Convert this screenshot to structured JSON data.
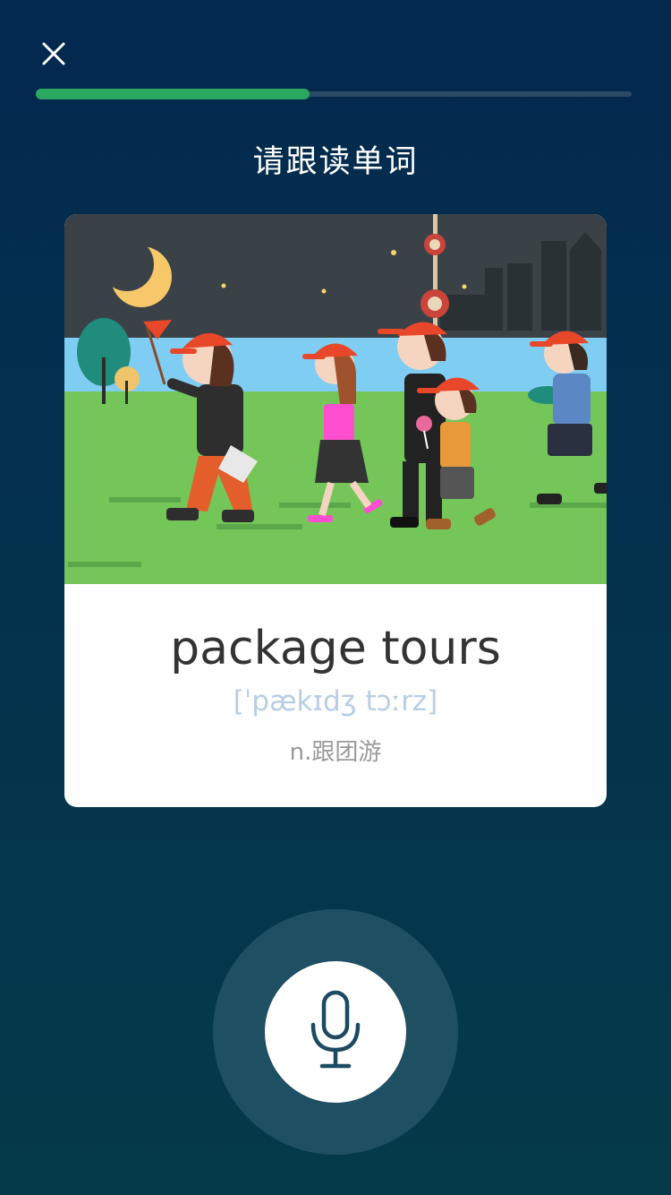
{
  "header": {
    "close_icon": "close-icon",
    "progress_fraction": 0.46
  },
  "instruction": "请跟读单词",
  "card": {
    "word": "package tours",
    "phonetic": "[ˈpækɪdʒ tɔːrz]",
    "definition": "n.跟团游"
  },
  "mic": {
    "icon": "microphone-icon"
  },
  "colors": {
    "background": "#03294e",
    "progress_fill": "#2aa760",
    "progress_track": "#2a4a66",
    "mic_ring": "#1f4f63",
    "mic_icon": "#1c4a60"
  }
}
